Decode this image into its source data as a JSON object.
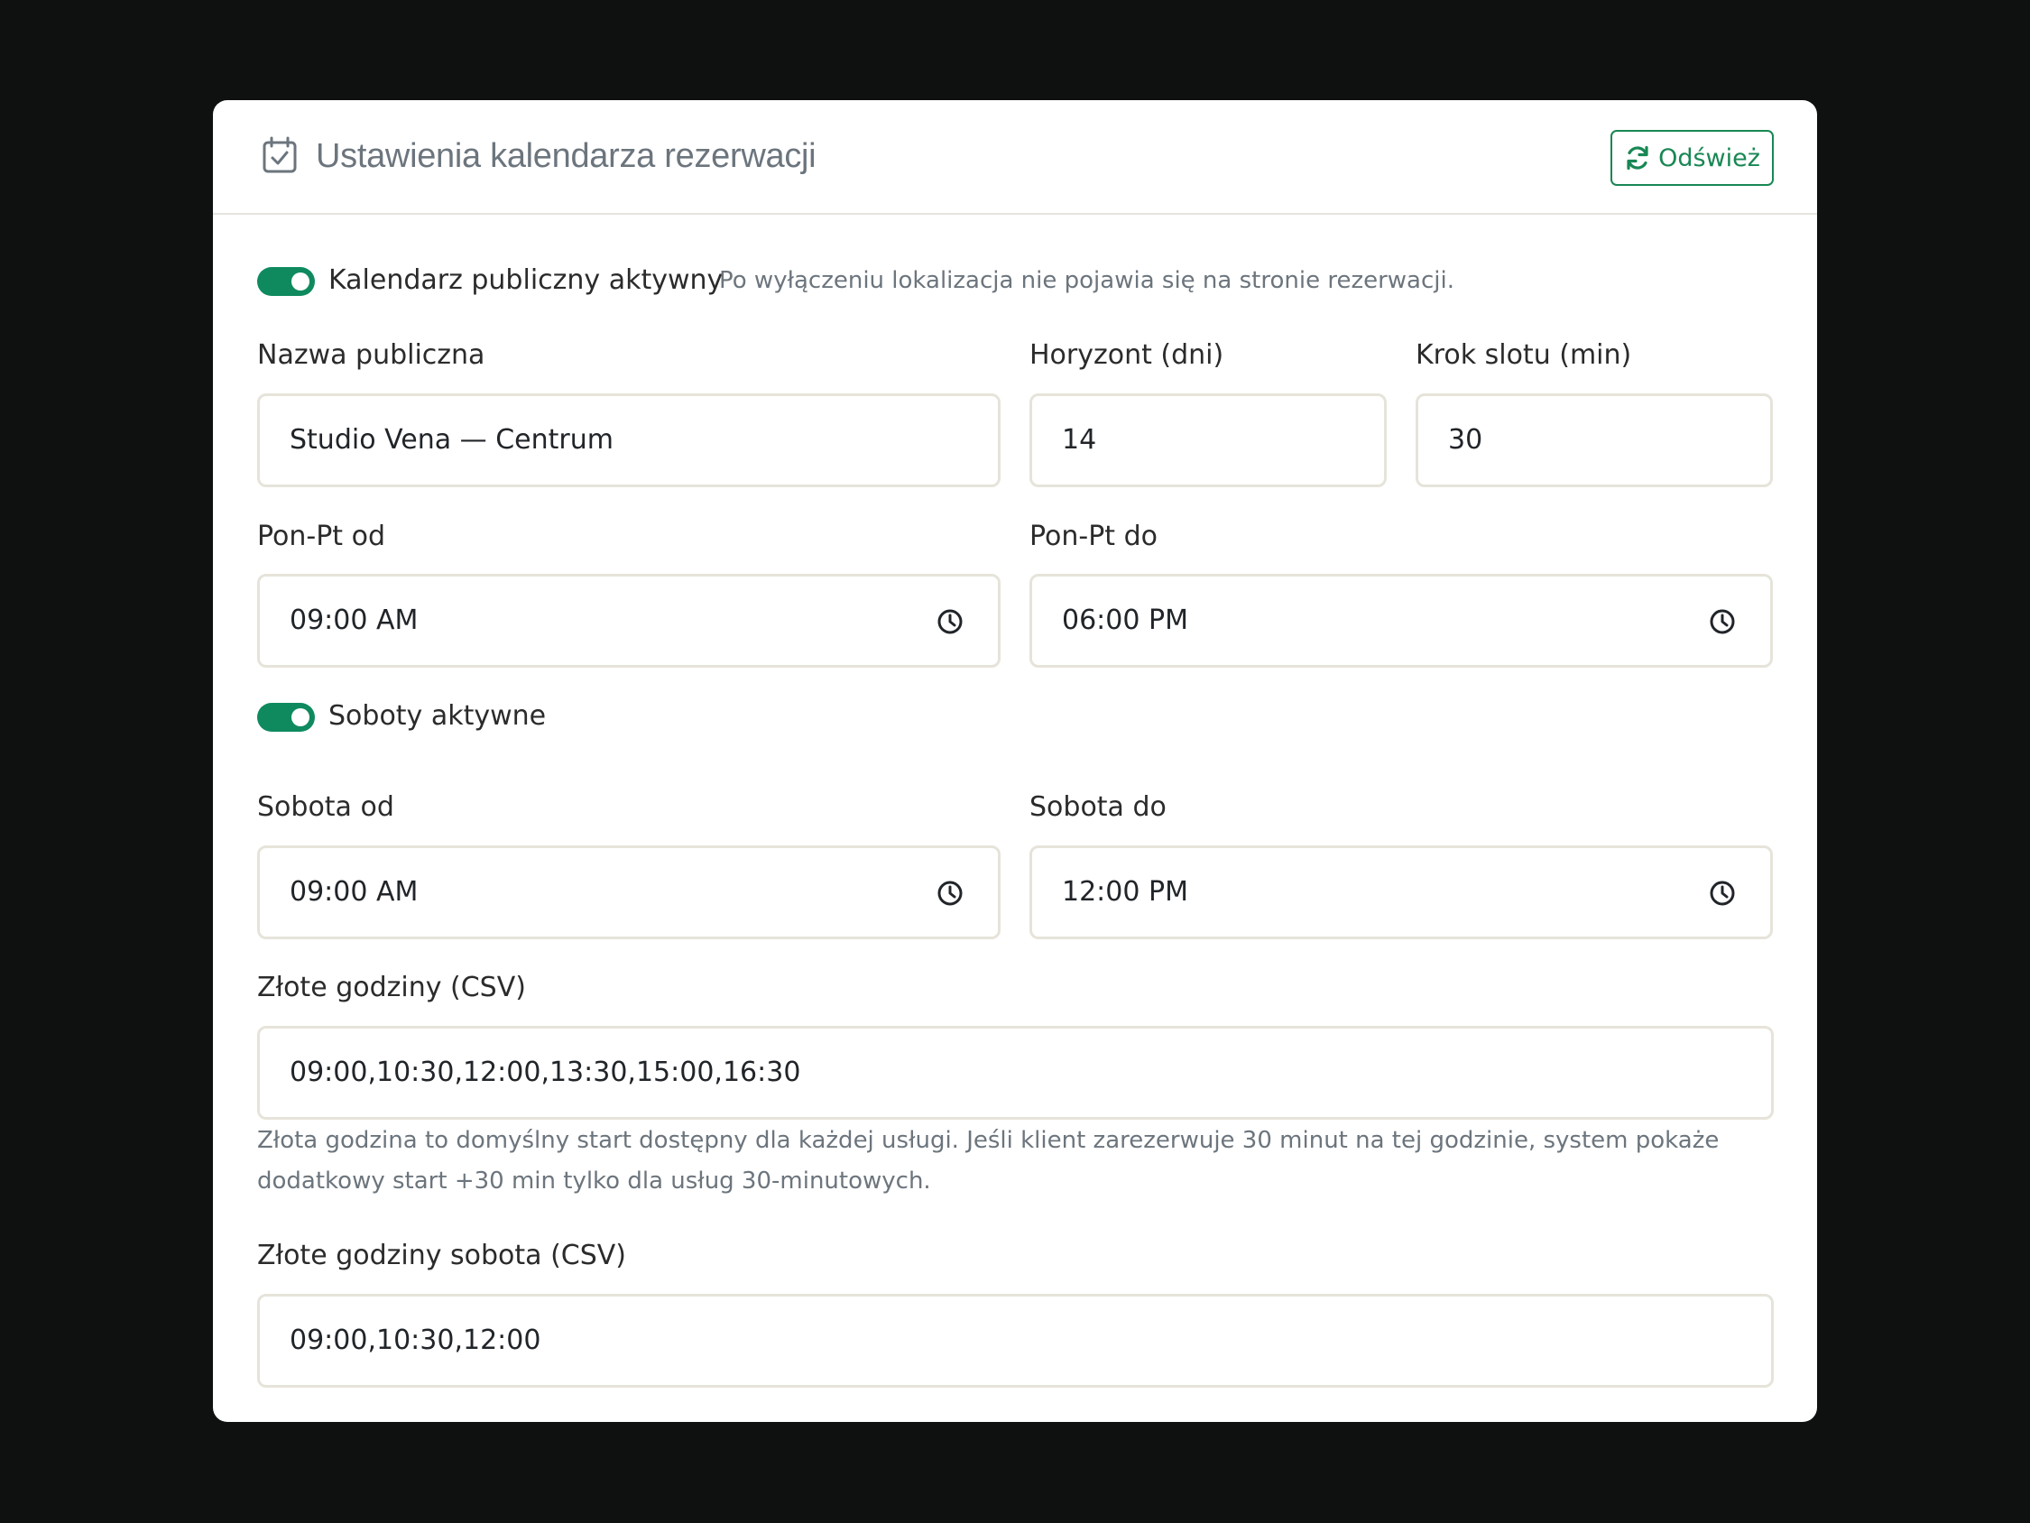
{
  "header": {
    "icon": "calendar-check-icon",
    "title": "Ustawienia kalendarza rezerwacji",
    "refresh_label": "Odśwież"
  },
  "public_calendar": {
    "enabled": true,
    "label": "Kalendarz publiczny aktywny",
    "hint": "Po wyłączeniu lokalizacja nie pojawia się na stronie rezerwacji."
  },
  "public_name": {
    "label": "Nazwa publiczna",
    "value": "Studio Vena — Centrum"
  },
  "horizon": {
    "label": "Horyzont (dni)",
    "value": "14"
  },
  "slot_step": {
    "label": "Krok slotu (min)",
    "value": "30"
  },
  "weekday_from": {
    "label": "Pon-Pt od",
    "value": "09:00  AM"
  },
  "weekday_to": {
    "label": "Pon-Pt do",
    "value": "06:00  PM"
  },
  "saturdays": {
    "enabled": true,
    "label": "Soboty aktywne"
  },
  "saturday_from": {
    "label": "Sobota od",
    "value": "09:00  AM"
  },
  "saturday_to": {
    "label": "Sobota do",
    "value": "12:00  PM"
  },
  "golden_hours": {
    "label": "Złote godziny (CSV)",
    "value": "09:00,10:30,12:00,13:30,15:00,16:30",
    "help": "Złota godzina to domyślny start dostępny dla każdej usługi. Jeśli klient zarezerwuje 30 minut na tej godzinie, system pokaże dodatkowy start +30 min tylko dla usług 30-minutowych."
  },
  "golden_hours_saturday": {
    "label": "Złote godziny sobota (CSV)",
    "value": "09:00,10:30,12:00"
  },
  "colors": {
    "accent": "#198754",
    "switch_on": "#0f8a5f",
    "background": "#0f1110",
    "field_border": "#e6e4da"
  }
}
